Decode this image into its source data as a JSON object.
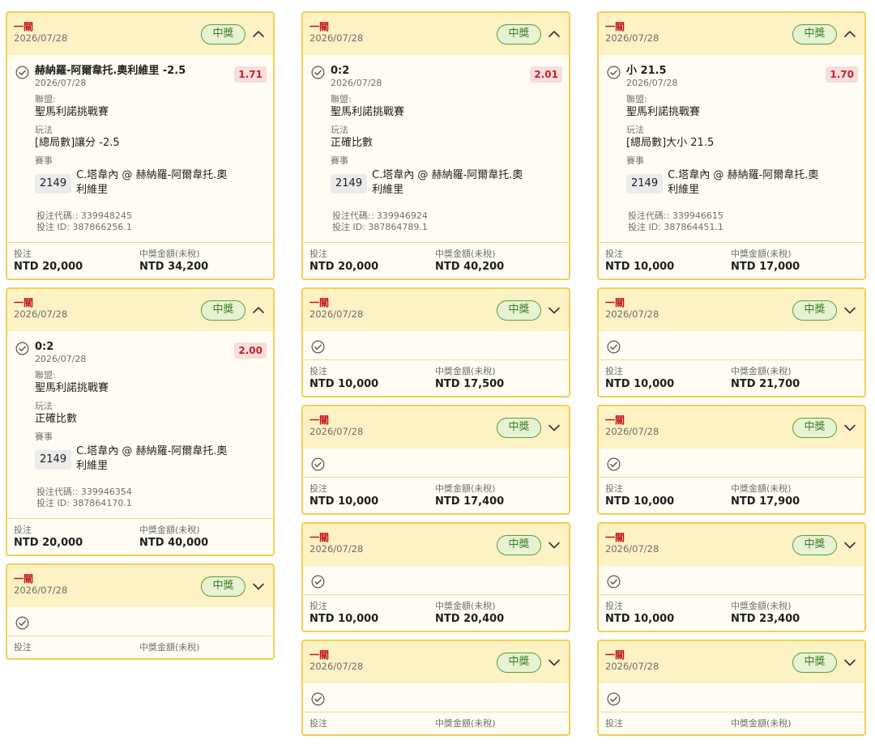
{
  "common": {
    "pass_type": "一關",
    "date": "2026/07/28",
    "status": "中獎",
    "league_label": "聯盟:",
    "playtype_label": "玩法",
    "event_label": "賽事",
    "stake_label": "投注",
    "payout_label": "中獎金額(未稅)"
  },
  "columns": [
    [
      {
        "expanded": true,
        "selection": "赫納羅-阿爾韋托.奧利維里 -2.5",
        "odds": "1.71",
        "league": "聖馬利諾挑戰賽",
        "play_type": "[總局數]讓分 -2.5",
        "event_id": "2149",
        "event_name": "C.塔韋內 @ 赫納羅-阿爾韋托.奧利維里",
        "bet_code": "投注代碼:: 339948245",
        "bet_id": "投注 ID: 387866256.1",
        "stake": "NTD 20,000",
        "payout": "NTD 34,200"
      },
      {
        "expanded": true,
        "selection": "0:2",
        "odds": "2.00",
        "league": "聖馬利諾挑戰賽",
        "play_type": "正確比數",
        "event_id": "2149",
        "event_name": "C.塔韋內 @ 赫納羅-阿爾韋托.奧利維里",
        "bet_code": "投注代碼:: 339946354",
        "bet_id": "投注 ID: 387864170.1",
        "stake": "NTD 20,000",
        "payout": "NTD 40,000"
      },
      {
        "expanded": false,
        "stake": "",
        "payout": ""
      }
    ],
    [
      {
        "expanded": true,
        "selection": "0:2",
        "odds": "2.01",
        "league": "聖馬利諾挑戰賽",
        "play_type": "正確比數",
        "event_id": "2149",
        "event_name": "C.塔韋內 @ 赫納羅-阿爾韋托.奧利維里",
        "bet_code": "投注代碼:: 339946924",
        "bet_id": "投注 ID: 387864789.1",
        "stake": "NTD 20,000",
        "payout": "NTD 40,200"
      },
      {
        "expanded": false,
        "stake": "NTD 10,000",
        "payout": "NTD 17,500"
      },
      {
        "expanded": false,
        "stake": "NTD 10,000",
        "payout": "NTD 17,400"
      },
      {
        "expanded": false,
        "stake": "NTD 10,000",
        "payout": "NTD 20,400"
      },
      {
        "expanded": false,
        "stake": "",
        "payout": ""
      }
    ],
    [
      {
        "expanded": true,
        "selection": "小 21.5",
        "odds": "1.70",
        "league": "聖馬利諾挑戰賽",
        "play_type": "[總局數]大小 21.5",
        "event_id": "2149",
        "event_name": "C.塔韋內 @ 赫納羅-阿爾韋托.奧利維里",
        "bet_code": "投注代碼:: 339946615",
        "bet_id": "投注 ID: 387864451.1",
        "stake": "NTD 10,000",
        "payout": "NTD 17,000"
      },
      {
        "expanded": false,
        "stake": "NTD 10,000",
        "payout": "NTD 21,700"
      },
      {
        "expanded": false,
        "stake": "NTD 10,000",
        "payout": "NTD 17,900"
      },
      {
        "expanded": false,
        "stake": "NTD 10,000",
        "payout": "NTD 23,400"
      },
      {
        "expanded": false,
        "stake": "",
        "payout": ""
      }
    ]
  ],
  "colors": {
    "card_border": "#f2cf57",
    "card_header": "#fcf2c4",
    "pass_type": "#c0141c",
    "odds_text": "#c4262b",
    "badge_green": "#59a03e"
  },
  "icons": {
    "status": "check-circle-icon",
    "expand": "chevron-down-icon",
    "collapse": "chevron-up-icon"
  }
}
